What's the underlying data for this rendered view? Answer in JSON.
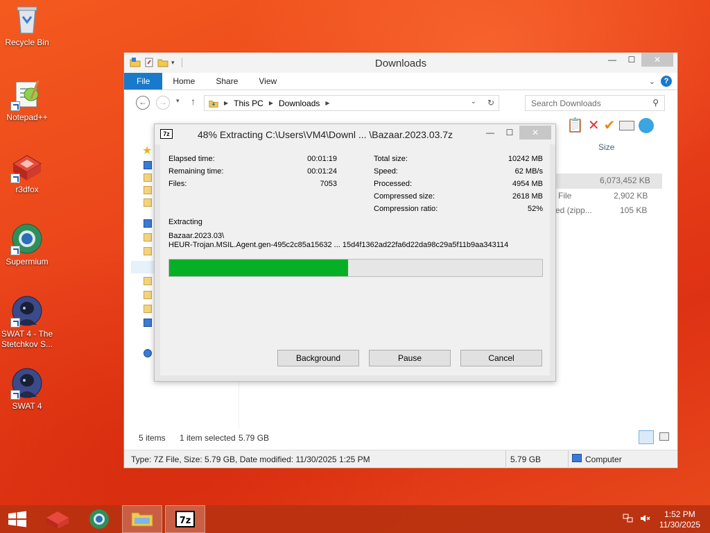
{
  "desktop": {
    "icons": [
      {
        "label": "Recycle Bin",
        "icon": "recycle-bin-icon"
      },
      {
        "label": "Notepad++",
        "icon": "notepad-plus-plus-icon"
      },
      {
        "label": "r3dfox",
        "icon": "r3dfox-icon"
      },
      {
        "label": "Supermium",
        "icon": "supermium-icon"
      },
      {
        "label": "SWAT 4 - The Stetchkov S...",
        "icon": "swat4-icon"
      },
      {
        "label": "SWAT 4",
        "icon": "swat4-icon"
      }
    ]
  },
  "explorer": {
    "title": "Downloads",
    "ribbon_tabs": [
      "File",
      "Home",
      "Share",
      "View"
    ],
    "breadcrumb": [
      "This PC",
      "Downloads"
    ],
    "search_placeholder": "Search Downloads",
    "column_size": "Size",
    "rows": [
      {
        "type": "",
        "size": "6,073,452 KB"
      },
      {
        "type": "File",
        "size": "2,902 KB"
      },
      {
        "type": "ed (zipp...",
        "size": "105 KB"
      }
    ],
    "status": {
      "items": "5 items",
      "selected": "1 item selected",
      "selected_size": "5.79 GB"
    },
    "details": {
      "info": "Type: 7Z File, Size: 5.79 GB, Date modified: 11/30/2025 1:25 PM",
      "size": "5.79 GB",
      "location": "Computer"
    }
  },
  "zip_dialog": {
    "app_logo": "7z",
    "title": "48% Extracting C:\\Users\\VM4\\Downl ... \\Bazaar.2023.03.7z",
    "left_stats": [
      {
        "label": "Elapsed time:",
        "value": "00:01:19"
      },
      {
        "label": "Remaining time:",
        "value": "00:01:24"
      },
      {
        "label": "Files:",
        "value": "7053"
      }
    ],
    "right_stats": [
      {
        "label": "Total size:",
        "value": "10242 MB"
      },
      {
        "label": "Speed:",
        "value": "62 MB/s"
      },
      {
        "label": "Processed:",
        "value": "4954 MB"
      },
      {
        "label": "Compressed size:",
        "value": "2618 MB"
      },
      {
        "label": "Compression ratio:",
        "value": "52%"
      }
    ],
    "operation": "Extracting",
    "path_line1": "Bazaar.2023.03\\",
    "path_line2": "HEUR-Trojan.MSIL.Agent.gen-495c2c85a15632 ... 15d4f1362ad22fa6d22da98c29a5f11b9aa343114",
    "progress_percent": 48,
    "buttons": {
      "background": "Background",
      "pause": "Pause",
      "cancel": "Cancel"
    }
  },
  "taskbar": {
    "clock_time": "1:52 PM",
    "clock_date": "11/30/2025",
    "pinned": [
      "start-icon",
      "r3dfox-icon",
      "supermium-icon",
      "file-explorer-icon",
      "7zip-icon"
    ]
  },
  "colors": {
    "accent": "#1979ca",
    "progress": "#06b025",
    "desktop": "#e8401a"
  }
}
